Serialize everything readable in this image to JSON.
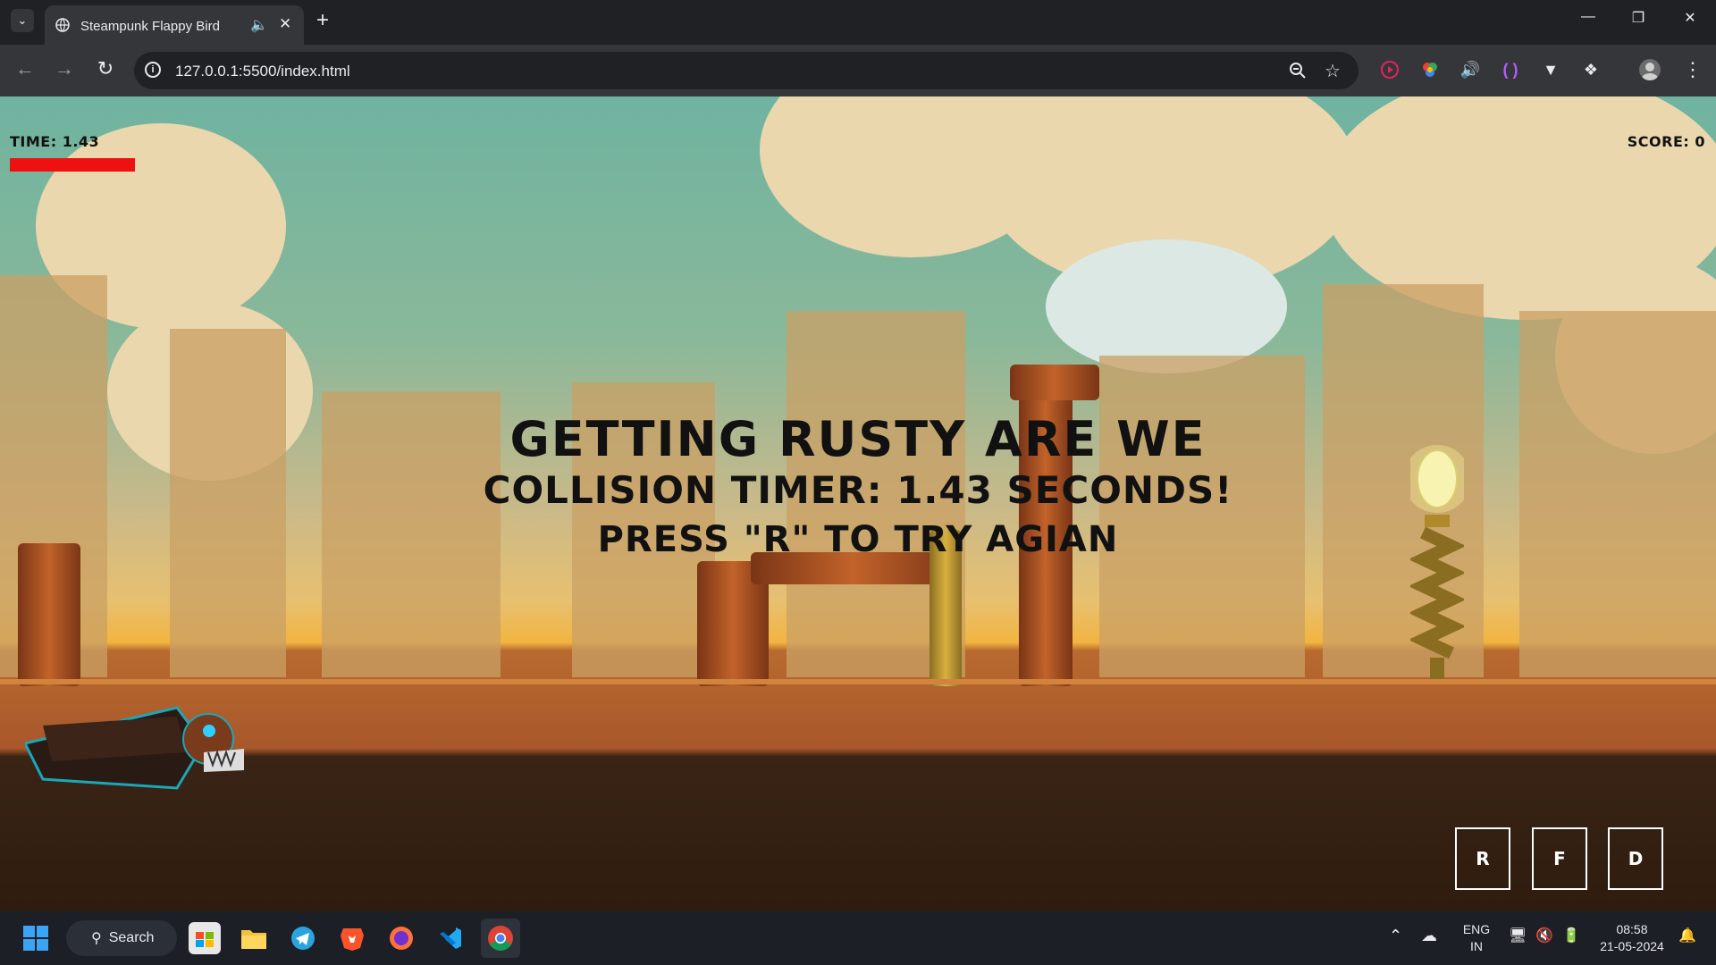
{
  "browser": {
    "tab_title": "Steampunk Flappy Bird",
    "url": "127.0.0.1:5500/index.html",
    "icons": [
      "tab-search-icon",
      "favicon-globe-icon",
      "audio-icon",
      "close-icon",
      "new-tab-icon",
      "minimize-icon",
      "restore-icon",
      "close-window-icon",
      "back-icon",
      "forward-icon",
      "reload-icon",
      "site-info-icon",
      "zoom-icon",
      "bookmark-star-icon",
      "extension-icons",
      "profile-avatar",
      "menu-icon"
    ]
  },
  "game": {
    "hud": {
      "time_label": "TIME: 1.43",
      "score_label": "SCORE: 0",
      "time_bar_color": "#ee1111"
    },
    "message": {
      "line1": "GETTING RUSTY ARE WE",
      "line2": "COLLISION TIMER: 1.43 SECONDS!",
      "line3": "PRESS \"R\" TO TRY AGIAN"
    },
    "buttons": [
      "R",
      "F",
      "D"
    ]
  },
  "taskbar": {
    "search_label": "Search",
    "language_line1": "ENG",
    "language_line2": "IN",
    "time": "08:58",
    "date": "21-05-2024"
  }
}
